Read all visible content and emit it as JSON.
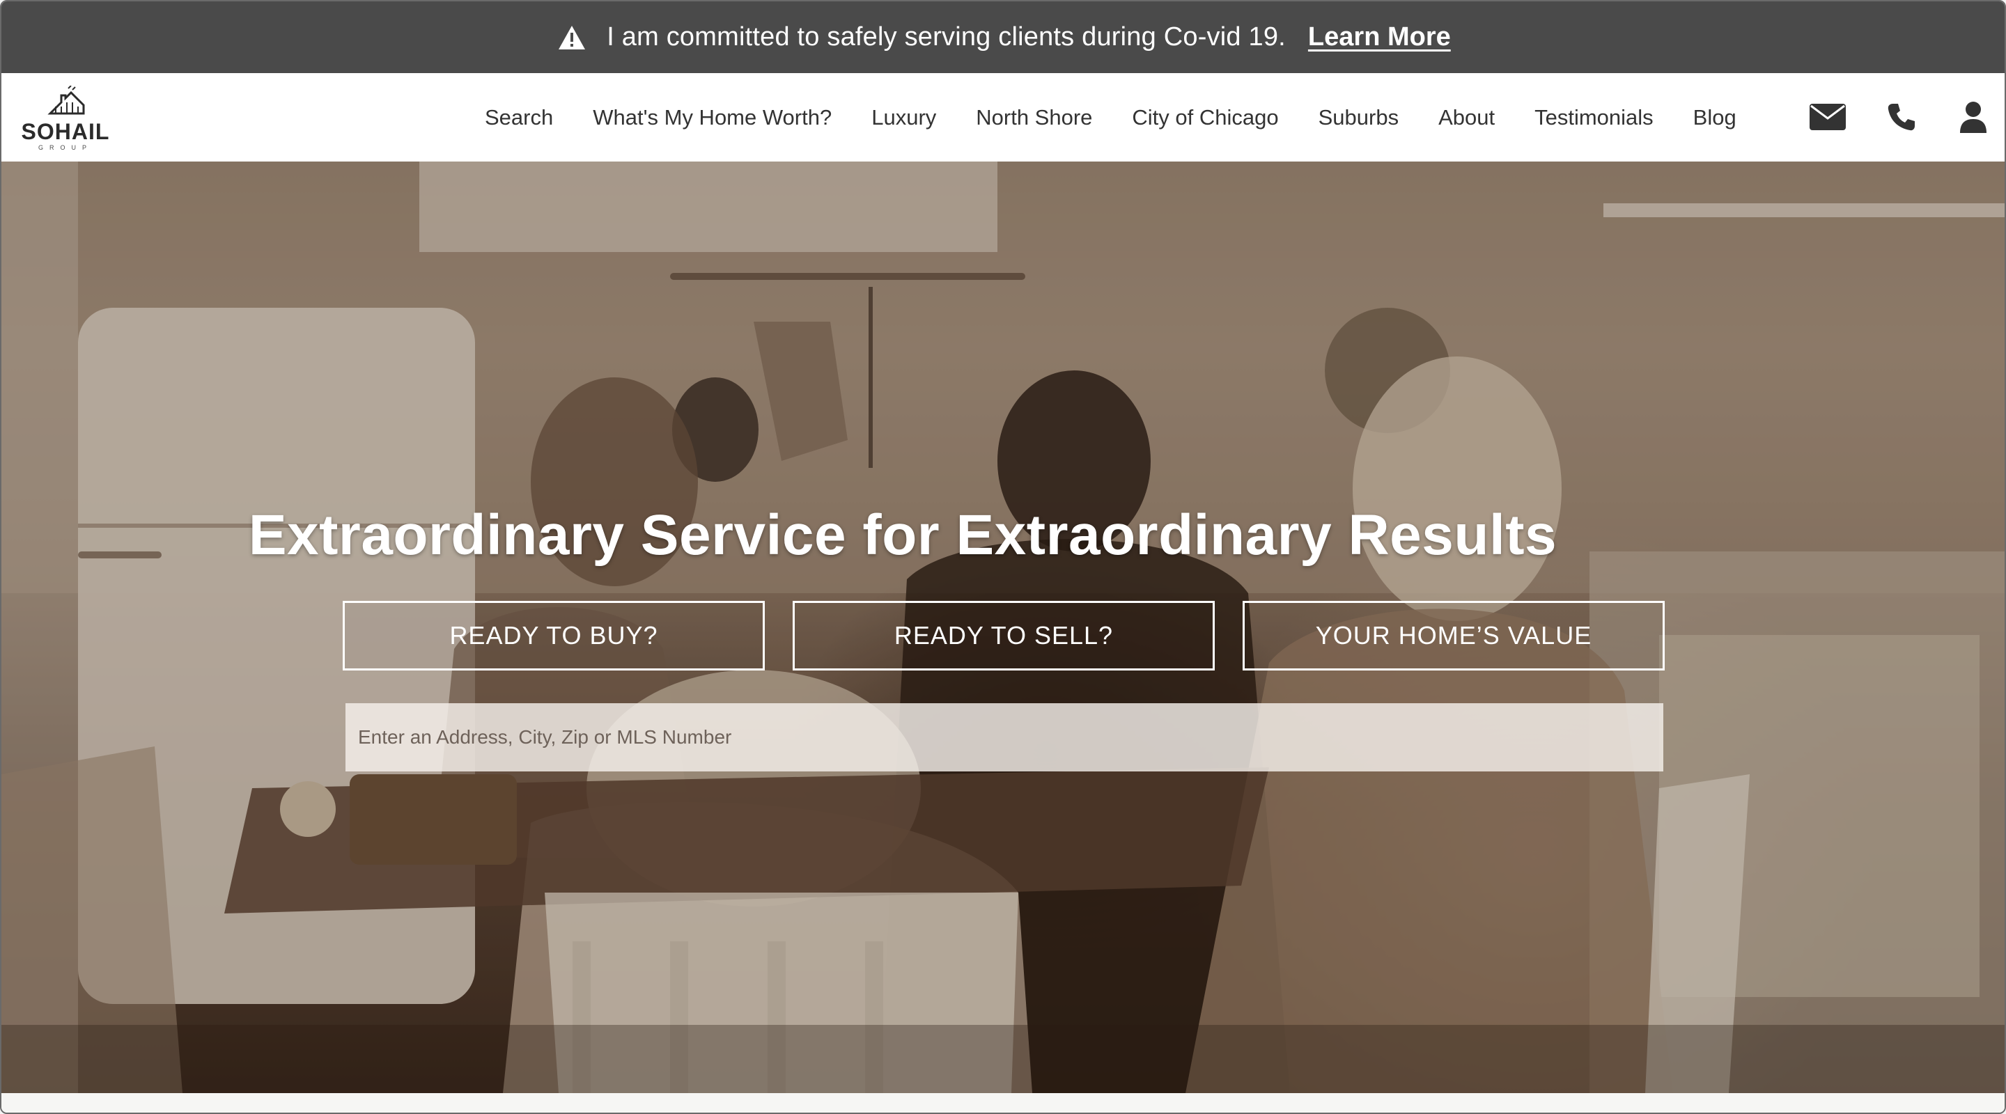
{
  "alert": {
    "icon": "warning-icon",
    "message": "I am committed to safely serving clients during Co-vid 19.",
    "link_label": "Learn More"
  },
  "brand": {
    "logo_text": "SOHAIL",
    "logo_subtext": "GROUP"
  },
  "nav": {
    "items": [
      {
        "label": "Search"
      },
      {
        "label": "What's My Home Worth?"
      },
      {
        "label": "Luxury"
      },
      {
        "label": "North Shore"
      },
      {
        "label": "City of Chicago"
      },
      {
        "label": "Suburbs"
      },
      {
        "label": "About"
      },
      {
        "label": "Testimonials"
      },
      {
        "label": "Blog"
      }
    ],
    "icons": [
      "envelope-icon",
      "phone-icon",
      "user-icon"
    ]
  },
  "hero": {
    "title": "Extraordinary Service for Extraordinary Results",
    "buttons": [
      {
        "label": "READY TO BUY?"
      },
      {
        "label": "READY TO SELL?"
      },
      {
        "label": "YOUR HOME’S VALUE"
      }
    ],
    "search_placeholder": "Enter an Address, City, Zip or MLS Number",
    "search_value": ""
  },
  "colors": {
    "alert_bg": "#4a4a4a",
    "header_bg": "#ffffff",
    "nav_text": "#333333",
    "hero_tone": "#8c7561",
    "hero_text": "#ffffff"
  }
}
